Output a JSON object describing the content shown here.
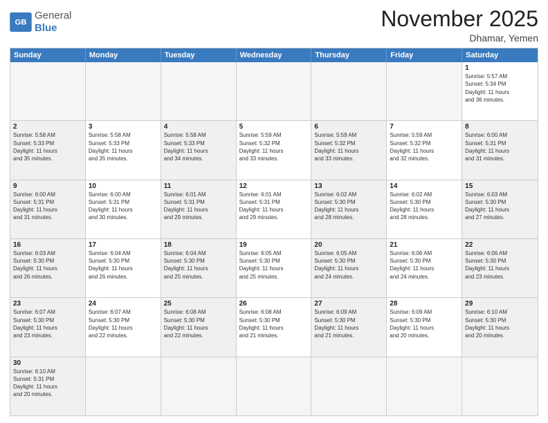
{
  "logo": {
    "text_general": "General",
    "text_blue": "Blue"
  },
  "title": "November 2025",
  "location": "Dhamar, Yemen",
  "header_days": [
    "Sunday",
    "Monday",
    "Tuesday",
    "Wednesday",
    "Thursday",
    "Friday",
    "Saturday"
  ],
  "rows": [
    [
      {
        "day": "",
        "info": "",
        "empty": true
      },
      {
        "day": "",
        "info": "",
        "empty": true
      },
      {
        "day": "",
        "info": "",
        "empty": true
      },
      {
        "day": "",
        "info": "",
        "empty": true
      },
      {
        "day": "",
        "info": "",
        "empty": true
      },
      {
        "day": "",
        "info": "",
        "empty": true
      },
      {
        "day": "1",
        "info": "Sunrise: 5:57 AM\nSunset: 5:34 PM\nDaylight: 11 hours\nand 36 minutes.",
        "empty": false
      }
    ],
    [
      {
        "day": "2",
        "info": "Sunrise: 5:58 AM\nSunset: 5:33 PM\nDaylight: 11 hours\nand 35 minutes.",
        "empty": false,
        "shaded": true
      },
      {
        "day": "3",
        "info": "Sunrise: 5:58 AM\nSunset: 5:33 PM\nDaylight: 11 hours\nand 35 minutes.",
        "empty": false
      },
      {
        "day": "4",
        "info": "Sunrise: 5:58 AM\nSunset: 5:33 PM\nDaylight: 11 hours\nand 34 minutes.",
        "empty": false,
        "shaded": true
      },
      {
        "day": "5",
        "info": "Sunrise: 5:59 AM\nSunset: 5:32 PM\nDaylight: 11 hours\nand 33 minutes.",
        "empty": false
      },
      {
        "day": "6",
        "info": "Sunrise: 5:59 AM\nSunset: 5:32 PM\nDaylight: 11 hours\nand 33 minutes.",
        "empty": false,
        "shaded": true
      },
      {
        "day": "7",
        "info": "Sunrise: 5:59 AM\nSunset: 5:32 PM\nDaylight: 11 hours\nand 32 minutes.",
        "empty": false
      },
      {
        "day": "8",
        "info": "Sunrise: 6:00 AM\nSunset: 5:31 PM\nDaylight: 11 hours\nand 31 minutes.",
        "empty": false,
        "shaded": true
      }
    ],
    [
      {
        "day": "9",
        "info": "Sunrise: 6:00 AM\nSunset: 5:31 PM\nDaylight: 11 hours\nand 31 minutes.",
        "empty": false,
        "shaded": true
      },
      {
        "day": "10",
        "info": "Sunrise: 6:00 AM\nSunset: 5:31 PM\nDaylight: 11 hours\nand 30 minutes.",
        "empty": false
      },
      {
        "day": "11",
        "info": "Sunrise: 6:01 AM\nSunset: 5:31 PM\nDaylight: 11 hours\nand 29 minutes.",
        "empty": false,
        "shaded": true
      },
      {
        "day": "12",
        "info": "Sunrise: 6:01 AM\nSunset: 5:31 PM\nDaylight: 11 hours\nand 29 minutes.",
        "empty": false
      },
      {
        "day": "13",
        "info": "Sunrise: 6:02 AM\nSunset: 5:30 PM\nDaylight: 11 hours\nand 28 minutes.",
        "empty": false,
        "shaded": true
      },
      {
        "day": "14",
        "info": "Sunrise: 6:02 AM\nSunset: 5:30 PM\nDaylight: 11 hours\nand 28 minutes.",
        "empty": false
      },
      {
        "day": "15",
        "info": "Sunrise: 6:03 AM\nSunset: 5:30 PM\nDaylight: 11 hours\nand 27 minutes.",
        "empty": false,
        "shaded": true
      }
    ],
    [
      {
        "day": "16",
        "info": "Sunrise: 6:03 AM\nSunset: 5:30 PM\nDaylight: 11 hours\nand 26 minutes.",
        "empty": false,
        "shaded": true
      },
      {
        "day": "17",
        "info": "Sunrise: 6:04 AM\nSunset: 5:30 PM\nDaylight: 11 hours\nand 26 minutes.",
        "empty": false
      },
      {
        "day": "18",
        "info": "Sunrise: 6:04 AM\nSunset: 5:30 PM\nDaylight: 11 hours\nand 25 minutes.",
        "empty": false,
        "shaded": true
      },
      {
        "day": "19",
        "info": "Sunrise: 6:05 AM\nSunset: 5:30 PM\nDaylight: 11 hours\nand 25 minutes.",
        "empty": false
      },
      {
        "day": "20",
        "info": "Sunrise: 6:05 AM\nSunset: 5:30 PM\nDaylight: 11 hours\nand 24 minutes.",
        "empty": false,
        "shaded": true
      },
      {
        "day": "21",
        "info": "Sunrise: 6:06 AM\nSunset: 5:30 PM\nDaylight: 11 hours\nand 24 minutes.",
        "empty": false
      },
      {
        "day": "22",
        "info": "Sunrise: 6:06 AM\nSunset: 5:30 PM\nDaylight: 11 hours\nand 23 minutes.",
        "empty": false,
        "shaded": true
      }
    ],
    [
      {
        "day": "23",
        "info": "Sunrise: 6:07 AM\nSunset: 5:30 PM\nDaylight: 11 hours\nand 23 minutes.",
        "empty": false,
        "shaded": true
      },
      {
        "day": "24",
        "info": "Sunrise: 6:07 AM\nSunset: 5:30 PM\nDaylight: 11 hours\nand 22 minutes.",
        "empty": false
      },
      {
        "day": "25",
        "info": "Sunrise: 6:08 AM\nSunset: 5:30 PM\nDaylight: 11 hours\nand 22 minutes.",
        "empty": false,
        "shaded": true
      },
      {
        "day": "26",
        "info": "Sunrise: 6:08 AM\nSunset: 5:30 PM\nDaylight: 11 hours\nand 21 minutes.",
        "empty": false
      },
      {
        "day": "27",
        "info": "Sunrise: 6:09 AM\nSunset: 5:30 PM\nDaylight: 11 hours\nand 21 minutes.",
        "empty": false,
        "shaded": true
      },
      {
        "day": "28",
        "info": "Sunrise: 6:09 AM\nSunset: 5:30 PM\nDaylight: 11 hours\nand 20 minutes.",
        "empty": false
      },
      {
        "day": "29",
        "info": "Sunrise: 6:10 AM\nSunset: 5:30 PM\nDaylight: 11 hours\nand 20 minutes.",
        "empty": false,
        "shaded": true
      }
    ],
    [
      {
        "day": "30",
        "info": "Sunrise: 6:10 AM\nSunset: 5:31 PM\nDaylight: 11 hours\nand 20 minutes.",
        "empty": false,
        "shaded": true
      },
      {
        "day": "",
        "info": "",
        "empty": true
      },
      {
        "day": "",
        "info": "",
        "empty": true
      },
      {
        "day": "",
        "info": "",
        "empty": true
      },
      {
        "day": "",
        "info": "",
        "empty": true
      },
      {
        "day": "",
        "info": "",
        "empty": true
      },
      {
        "day": "",
        "info": "",
        "empty": true
      }
    ]
  ]
}
